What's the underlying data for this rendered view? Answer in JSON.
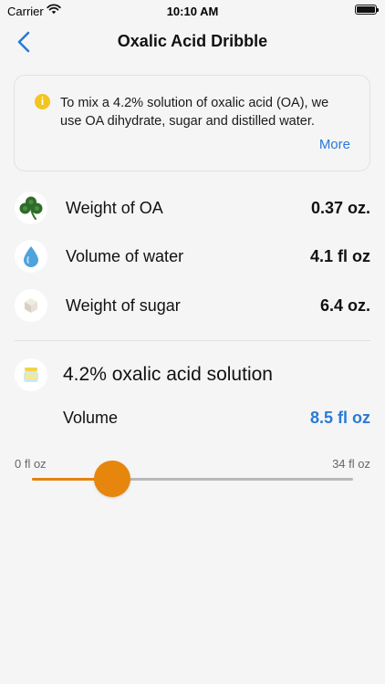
{
  "status_bar": {
    "carrier": "Carrier",
    "time": "10:10 AM"
  },
  "nav": {
    "title": "Oxalic Acid Dribble",
    "back_icon": "chevron-left-icon"
  },
  "info": {
    "icon": "info-icon",
    "icon_glyph": "i",
    "text": "To mix a 4.2% solution of oxalic acid (OA), we use OA dihydrate, sugar and distilled water.",
    "more_label": "More"
  },
  "ingredients": [
    {
      "icon": "clover-icon",
      "label": "Weight of OA",
      "value": "0.37 oz."
    },
    {
      "icon": "water-drop-icon",
      "label": "Volume of water",
      "value": "4.1 fl oz"
    },
    {
      "icon": "sugar-cube-icon",
      "label": "Weight of sugar",
      "value": "6.4 oz."
    }
  ],
  "solution": {
    "icon": "jar-icon",
    "title": "4.2% oxalic acid solution",
    "volume_label": "Volume",
    "volume_value": "8.5 fl oz"
  },
  "slider": {
    "min_label": "0 fl oz",
    "max_label": "34 fl oz",
    "min": 0,
    "max": 34,
    "value": 8.5
  },
  "colors": {
    "accent": "#2a7ad5",
    "slider_active": "#e6820e",
    "info_icon": "#f3c521",
    "background": "#f5f5f6"
  }
}
